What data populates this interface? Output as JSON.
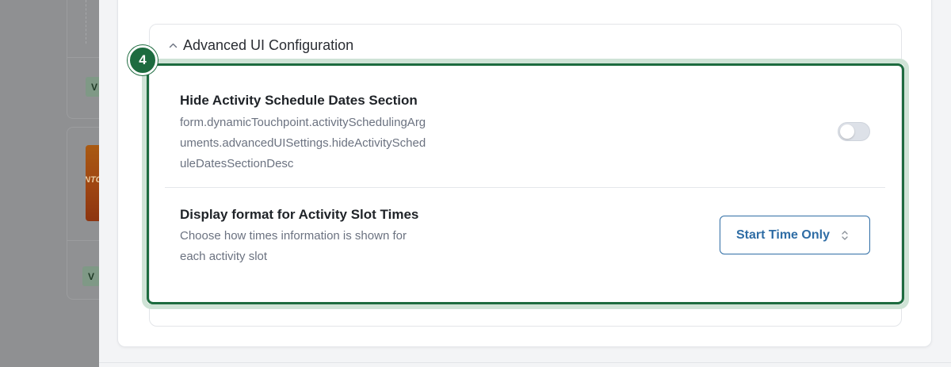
{
  "background": {
    "tags": [
      "V",
      "V"
    ],
    "thumbnail_text": "NTC"
  },
  "section": {
    "step_badge": "4",
    "title": "Advanced UI Configuration",
    "expanded": true
  },
  "settings": [
    {
      "title": "Hide Activity Schedule Dates Section",
      "description": "form.dynamicTouchpoint.activitySchedulingArguments.advancedUISettings.hideActivityScheduleDatesSectionDesc",
      "description_lines": [
        "form.dynamicTouchpoint.activitySchedulingArg",
        "uments.advancedUISettings.hideActivitySched",
        "uleDatesSectionDesc"
      ],
      "control": "toggle",
      "enabled": false
    },
    {
      "title": "Display format for Activity Slot Times",
      "description": "Choose how times information is shown for each activity slot",
      "description_lines": [
        "Choose how times information is shown for",
        "each activity slot"
      ],
      "control": "select",
      "selected": "Start Time Only"
    }
  ],
  "colors": {
    "highlight_border": "#1d6b3f",
    "select_accent": "#2f6da5",
    "overlay": "#8e8f91"
  }
}
